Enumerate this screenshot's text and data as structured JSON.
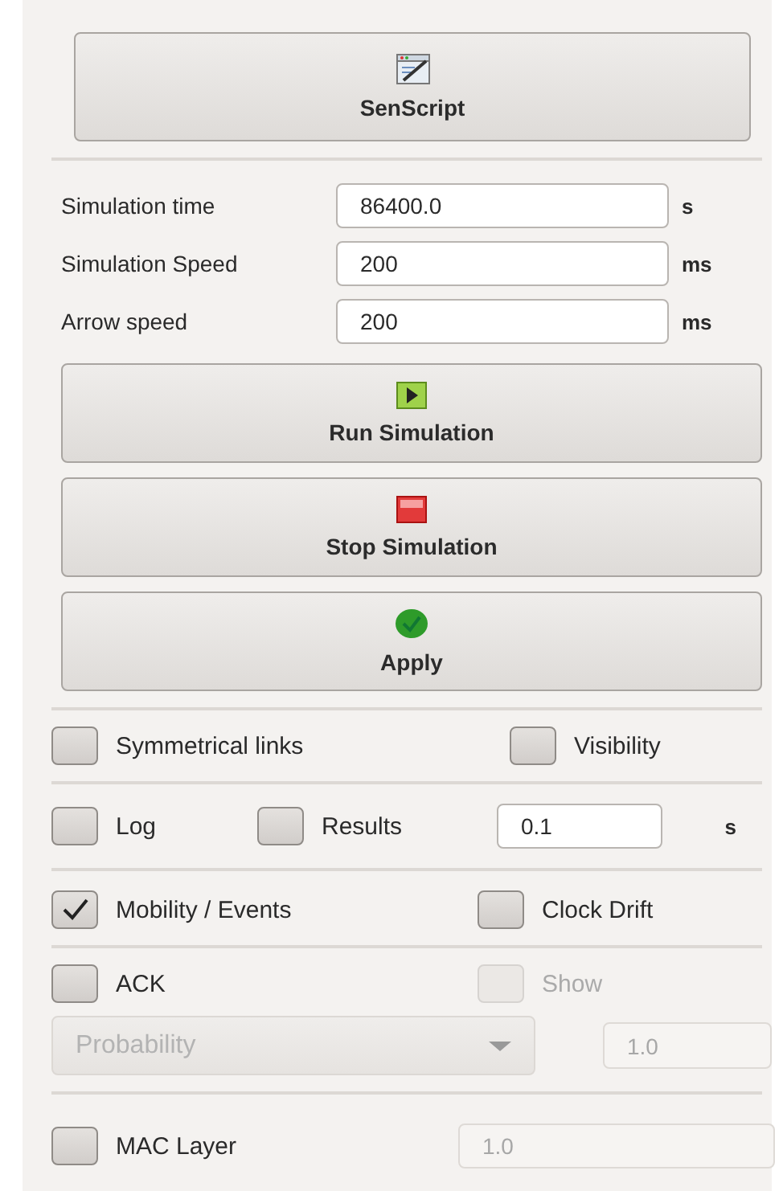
{
  "senscript_button": {
    "label": "SenScript"
  },
  "simulation_fields": [
    {
      "label": "Simulation time",
      "value": "86400.0",
      "unit": "s"
    },
    {
      "label": "Simulation Speed",
      "value": "200",
      "unit": "ms"
    },
    {
      "label": "Arrow speed",
      "value": "200",
      "unit": "ms"
    }
  ],
  "action_buttons": [
    {
      "kind": "run",
      "label": "Run Simulation"
    },
    {
      "kind": "stop",
      "label": "Stop Simulation"
    },
    {
      "kind": "apply",
      "label": "Apply"
    }
  ],
  "option_groups": [
    {
      "rows": [
        {
          "items": [
            {
              "kind": "checkbox",
              "label": "Symmetrical links",
              "checked": false,
              "disabled": false
            },
            {
              "kind": "checkbox",
              "label": "Visibility",
              "checked": false,
              "disabled": false
            }
          ]
        }
      ]
    },
    {
      "rows": [
        {
          "items": [
            {
              "kind": "checkbox",
              "label": "Log",
              "checked": false,
              "disabled": false
            },
            {
              "kind": "checkbox",
              "label": "Results",
              "checked": false,
              "disabled": false
            },
            {
              "kind": "field",
              "value": "0.1",
              "disabled": false
            },
            {
              "kind": "unit",
              "label": "s"
            }
          ]
        }
      ]
    },
    {
      "rows": [
        {
          "items": [
            {
              "kind": "checkbox",
              "label": "Mobility / Events",
              "checked": true,
              "disabled": false
            },
            {
              "kind": "checkbox",
              "label": "Clock Drift",
              "checked": false,
              "disabled": false
            }
          ]
        }
      ]
    },
    {
      "rows": [
        {
          "items": [
            {
              "kind": "checkbox",
              "label": "ACK",
              "checked": false,
              "disabled": false
            },
            {
              "kind": "checkbox",
              "label": "Show",
              "checked": false,
              "disabled": true
            }
          ]
        },
        {
          "items": [
            {
              "kind": "dropdown",
              "value": "Probability",
              "disabled": true
            },
            {
              "kind": "field",
              "value": "1.0",
              "disabled": true
            }
          ]
        }
      ]
    },
    {
      "rows": [
        {
          "items": [
            {
              "kind": "checkbox",
              "label": "MAC Layer",
              "checked": false,
              "disabled": false
            },
            {
              "kind": "field",
              "value": "1.0",
              "disabled": true
            }
          ]
        }
      ]
    }
  ]
}
